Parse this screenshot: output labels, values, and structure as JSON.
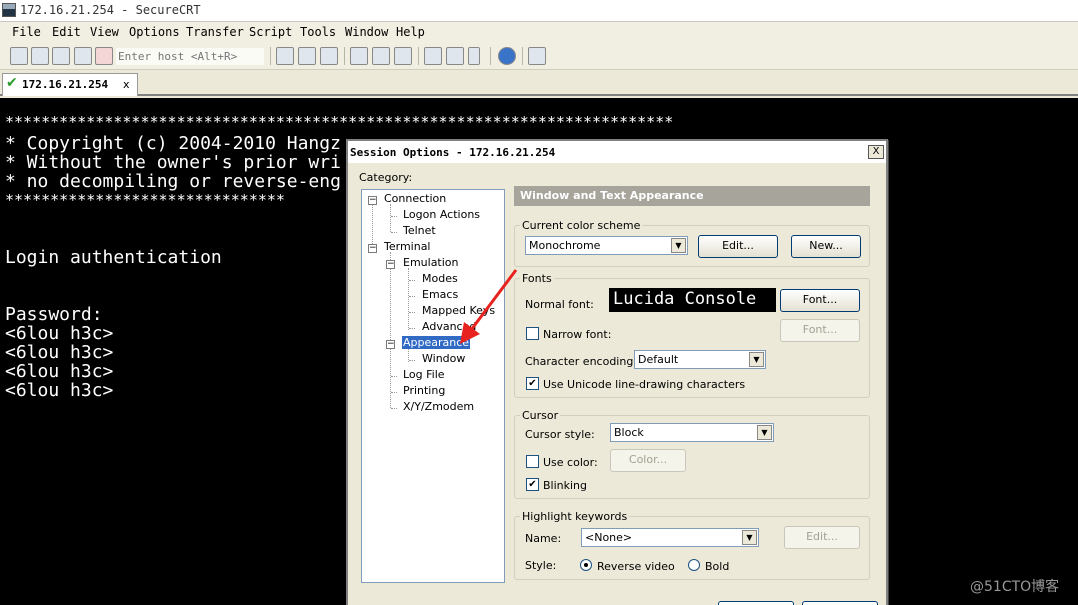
{
  "window": {
    "title": "172.16.21.254 - SecureCRT"
  },
  "menu": [
    "File",
    "Edit",
    "View",
    "Options",
    "Transfer",
    "Script",
    "Tools",
    "Window",
    "Help"
  ],
  "toolbar": {
    "host_placeholder": "Enter host <Alt+R>"
  },
  "tab": {
    "label": "172.16.21.254",
    "close": "x"
  },
  "terminal": {
    "lines": [
      "**************************************************************************",
      "* Copyright (c) 2004-2010 Hangz",
      "* Without the owner's prior wri",
      "* no decompiling or reverse-eng",
      "*******************************",
      "Login authentication",
      "Password:",
      "<6lou h3c>",
      "<6lou h3c>",
      "<6lou h3c>",
      "<6lou h3c>"
    ]
  },
  "dialog": {
    "title": "Session Options - 172.16.21.254",
    "close": "X",
    "category_label": "Category:",
    "tree": [
      "Connection",
      "Logon Actions",
      "Telnet",
      "Terminal",
      "Emulation",
      "Modes",
      "Emacs",
      "Mapped Keys",
      "Advanced",
      "Appearance",
      "Window",
      "Log File",
      "Printing",
      "X/Y/Zmodem"
    ],
    "panel_title": "Window and Text Appearance",
    "color_scheme": {
      "group": "Current color scheme",
      "value": "Monochrome",
      "edit": "Edit...",
      "new": "New..."
    },
    "fonts": {
      "group": "Fonts",
      "normal_label": "Normal font:",
      "normal_preview": "Lucida Console",
      "font_btn": "Font...",
      "narrow_label": "Narrow font:",
      "narrow_btn": "Font...",
      "narrow_checked": false,
      "encoding_label": "Character encoding:",
      "encoding_value": "Default",
      "unicode_label": "Use Unicode line-drawing characters",
      "unicode_checked": true
    },
    "cursor": {
      "group": "Cursor",
      "style_label": "Cursor style:",
      "style_value": "Block",
      "use_color_label": "Use color:",
      "use_color_checked": false,
      "color_btn": "Color...",
      "blinking_label": "Blinking",
      "blinking_checked": true
    },
    "highlight": {
      "group": "Highlight keywords",
      "name_label": "Name:",
      "name_value": "<None>",
      "edit_btn": "Edit...",
      "style_label": "Style:",
      "reverse_label": "Reverse video",
      "bold_label": "Bold",
      "selected_style": "Reverse video"
    }
  },
  "watermark": "@51CTO博客",
  "colors": {
    "terminal_bg": "#000000",
    "terminal_fg": "#ffffff",
    "selection": "#316ac5",
    "annotation_arrow": "#e8231f"
  }
}
